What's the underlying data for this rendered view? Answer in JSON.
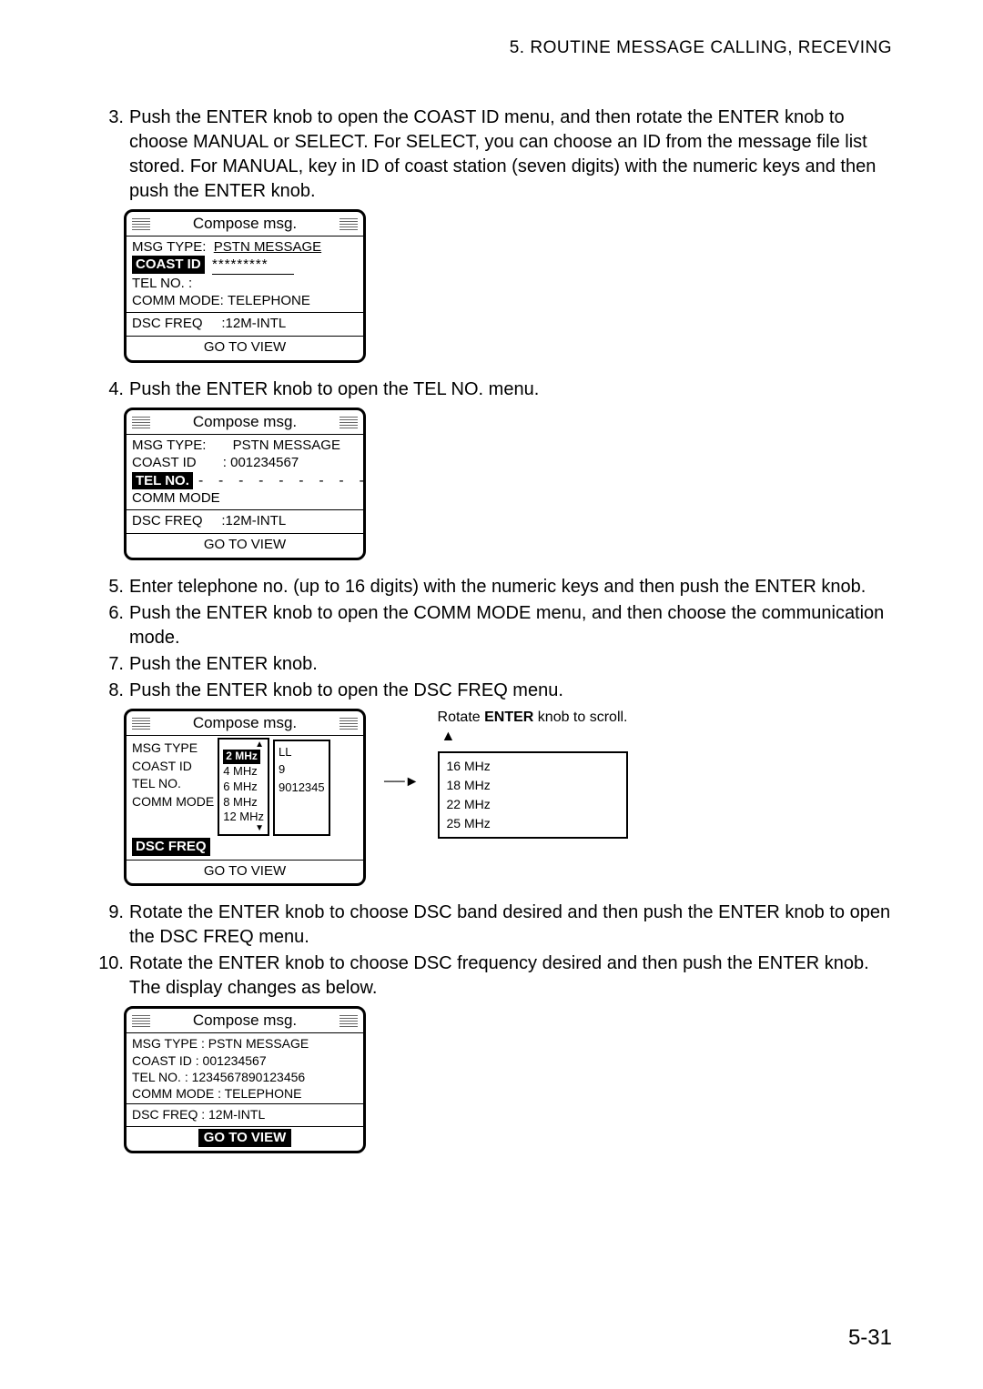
{
  "header": "5. ROUTINE MESSAGE CALLING, RECEVING",
  "page_number": "5-31",
  "steps": {
    "s3": {
      "n": "3.",
      "t": "Push the ENTER knob to open the COAST ID menu, and then rotate the ENTER knob to choose MANUAL or SELECT. For SELECT, you can choose an ID from the message file list stored. For MANUAL, key in ID of coast station (seven digits) with the numeric keys and then push the ENTER knob."
    },
    "s4": {
      "n": "4.",
      "t": "Push the ENTER knob to open the TEL NO. menu."
    },
    "s5": {
      "n": "5.",
      "t": "Enter telephone no. (up to 16 digits) with the numeric keys and then push the ENTER knob."
    },
    "s6": {
      "n": "6.",
      "t": "Push the ENTER knob to open the COMM MODE menu, and then choose the communication mode."
    },
    "s7": {
      "n": "7.",
      "t": "Push the ENTER knob."
    },
    "s8": {
      "n": "8.",
      "t": "Push the ENTER knob to open the DSC FREQ menu."
    },
    "s9": {
      "n": "9.",
      "t": "Rotate the ENTER knob to choose DSC band desired and then push the ENTER knob to open the DSC FREQ menu."
    },
    "s10": {
      "n": "10.",
      "t": "Rotate the ENTER knob to choose DSC frequency desired and then push the ENTER knob. The display changes as below."
    }
  },
  "labels": {
    "compose": "Compose msg.",
    "msg_type": "MSG TYPE:",
    "msg_type_nc": "MSG TYPE",
    "pstn": "PSTN MESSAGE",
    "coast_id_sel": "COAST ID",
    "coast_id": "COAST ID",
    "tel_no": "TEL NO.",
    "tel_no_colon": "TEL NO. :",
    "comm_mode": "COMM MODE:",
    "comm_mode_nc": "COMM MODE",
    "telephone": "TELEPHONE",
    "dsc_freq": "DSC FREQ",
    "go_to_view": "GO TO VIEW",
    "freq_val": ":12M-INTL",
    "stars": "*********",
    "coast_val": ": 001234567",
    "dashes": "- - - - - - - - - - - - - -",
    "rotate_hint_a": "Rotate ",
    "rotate_hint_b": "ENTER",
    "rotate_hint_c": " knob to scroll.",
    "side_vals_partial": "9012345",
    "ll": "LL"
  },
  "freq_list1": {
    "sel": "2 MHz",
    "f2": "4 MHz",
    "f3": "6 MHz",
    "f4": "8 MHz",
    "f5": "12 MHz"
  },
  "freq_list2": {
    "f1": "16 MHz",
    "f2": "18 MHz",
    "f3": "22 MHz",
    "f4": "25 MHz"
  },
  "screen4": {
    "msg_type": "MSG TYPE  : PSTN MESSAGE",
    "coast": "COAST    ID : 001234567",
    "tel": "TEL NO.   :  1234567890123456",
    "comm": "COMM MODE : TELEPHONE",
    "dsc": "DSC FREQ   :            12M-INTL",
    "go": "GO TO VIEW"
  }
}
